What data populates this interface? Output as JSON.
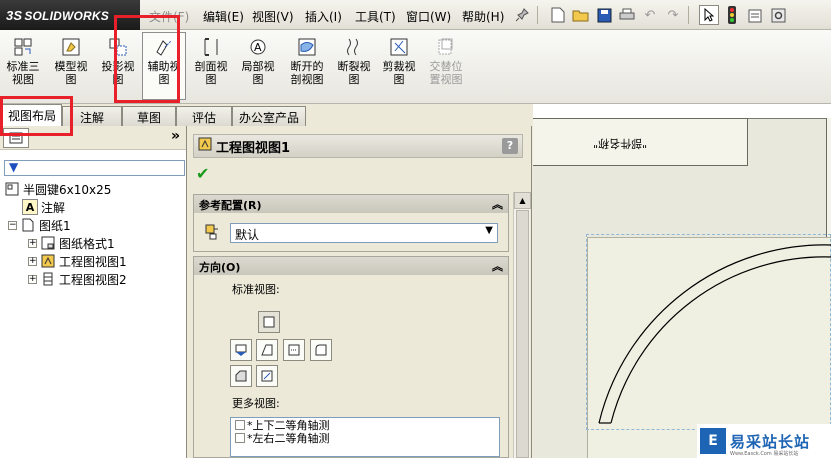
{
  "app": {
    "logo_ds": "3S",
    "logo_name": "SOLIDWORKS"
  },
  "menus": [
    {
      "label": "文件(F)",
      "dim": true
    },
    {
      "label": "编辑(E)"
    },
    {
      "label": "视图(V)"
    },
    {
      "label": "插入(I)"
    },
    {
      "label": "工具(T)"
    },
    {
      "label": "窗口(W)"
    },
    {
      "label": "帮助(H)"
    }
  ],
  "commands": [
    {
      "label": "标准三\n视图"
    },
    {
      "label": "模型视\n图"
    },
    {
      "label": "投影视\n图"
    },
    {
      "label": "辅助视\n图",
      "active": true
    },
    {
      "label": "剖面视\n图"
    },
    {
      "label": "局部视\n图"
    },
    {
      "label": "断开的\n剖视图"
    },
    {
      "label": "断裂视\n图"
    },
    {
      "label": "剪裁视\n图"
    },
    {
      "label": "交替位\n置视图",
      "dim": true
    }
  ],
  "tabs": [
    "视图布局",
    "注解",
    "草图",
    "评估",
    "办公室产品"
  ],
  "tree": {
    "root": "半圆键6x10x25",
    "annotations": "注解",
    "sheet": "图纸1",
    "sheet_format": "图纸格式1",
    "view1": "工程图视图1",
    "view2": "工程图视图2"
  },
  "pm": {
    "title": "工程图视图1",
    "help": "?",
    "ref_header": "参考配置(R)",
    "ref_value": "默认",
    "orient_header": "方向(O)",
    "std_views_label": "标准视图:",
    "more_views_label": "更多视图:",
    "more_views": [
      "*上下二等角轴测",
      "*左右二等角轴测"
    ]
  },
  "drawing": {
    "note": "\"部件名称\""
  },
  "watermark": {
    "logo": "E",
    "text": "易采站长站",
    "sub": "Www.Easck.Com  易采站长站"
  }
}
